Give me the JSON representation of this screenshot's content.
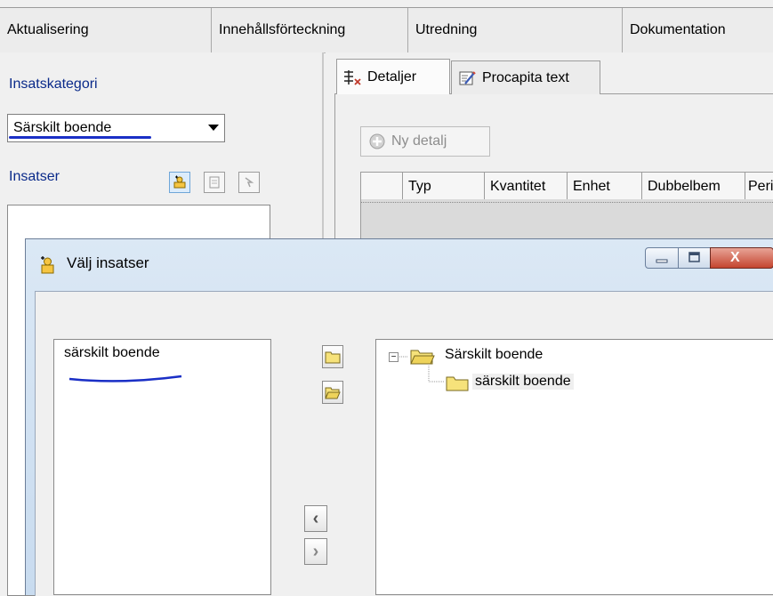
{
  "top_tabs": [
    "Aktualisering",
    "Innehållsförteckning",
    "Utredning",
    "Dokumentation"
  ],
  "left_pane": {
    "category_label": "Insatskategori",
    "category_selected": "Särskilt boende",
    "insatser_label": "Insatser"
  },
  "right_pane": {
    "tabs": [
      "Detaljer",
      "Procapita text"
    ],
    "new_detail_button": "Ny detalj",
    "columns": [
      "Typ",
      "Kvantitet",
      "Enhet",
      "Dubbelbem",
      "Peri"
    ]
  },
  "dialog": {
    "title": "Välj insatser",
    "close_glyph": "X",
    "selected_items": [
      "särskilt boende"
    ],
    "tree": {
      "root": "Särskilt boende",
      "child": "särskilt boende"
    },
    "left_arrow": "‹",
    "right_arrow": "›"
  },
  "colors": {
    "accent_text": "#0a2a8a",
    "annotation_underline": "#1a2fc6",
    "folder": "#f6e27a"
  }
}
